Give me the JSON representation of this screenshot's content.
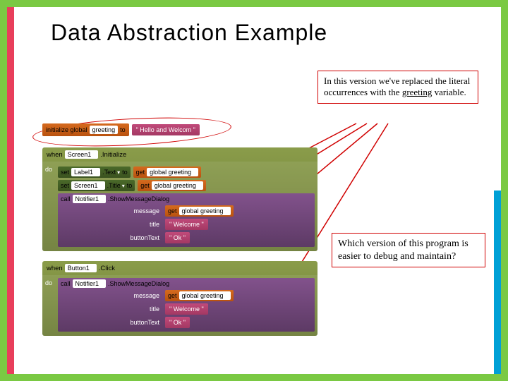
{
  "title": "Data Abstraction Example",
  "annotations": {
    "top": {
      "text_pre": "In this version we've replaced the literal occurrences with the ",
      "underlined": "greeting",
      "text_post": " variable."
    },
    "bottom": "Which version of this program is easier to debug and maintain?"
  },
  "blocks": {
    "init": {
      "label_pre": "initialize global",
      "var_name": "greeting",
      "label_mid": "to",
      "value": "\" Hello and Welcom \""
    },
    "event1": {
      "when": "when",
      "target": "Screen1",
      "event": ".Initialize",
      "do": "do",
      "rows": [
        {
          "kind": "set",
          "set": "set",
          "obj": "Label1",
          "prop": ".Text",
          "to": "to",
          "rhs_kind": "get",
          "rhs": "get",
          "rhs_var": "global greeting"
        },
        {
          "kind": "set",
          "set": "set",
          "obj": "Screen1",
          "prop": ".Title",
          "to": "to",
          "rhs_kind": "get",
          "rhs": "get",
          "rhs_var": "global greeting"
        },
        {
          "kind": "call",
          "call": "call",
          "obj": "Notifier1",
          "method": ".ShowMessageDialog",
          "slots": [
            {
              "name": "message",
              "rhs_kind": "get",
              "rhs": "get",
              "rhs_var": "global greeting"
            },
            {
              "name": "title",
              "rhs_kind": "text",
              "value": "\" Welcome \""
            },
            {
              "name": "buttonText",
              "rhs_kind": "text",
              "value": "\" Ok \""
            }
          ]
        }
      ]
    },
    "event2": {
      "when": "when",
      "target": "Button1",
      "event": ".Click",
      "do": "do",
      "rows": [
        {
          "kind": "call",
          "call": "call",
          "obj": "Notifier1",
          "method": ".ShowMessageDialog",
          "slots": [
            {
              "name": "message",
              "rhs_kind": "get",
              "rhs": "get",
              "rhs_var": "global greeting"
            },
            {
              "name": "title",
              "rhs_kind": "text",
              "value": "\" Welcome \""
            },
            {
              "name": "buttonText",
              "rhs_kind": "text",
              "value": "\" Ok \""
            }
          ]
        }
      ]
    }
  }
}
